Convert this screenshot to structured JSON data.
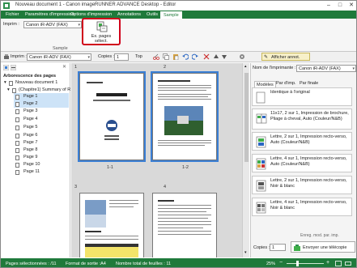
{
  "window": {
    "title": "Nouveau document 1 - Canon imageRUNNER ADVANCE Desktop - Editor",
    "minimize": "–",
    "maximize": "□",
    "close": "✕"
  },
  "ribbon": {
    "tabs": [
      "Fichier",
      "Paramètres d'impression",
      "Options d'impression",
      "Annotations",
      "Outils",
      "Sample"
    ],
    "active_tab_index": 5,
    "printer_label": "Imprim :",
    "printer_value": "Canon iR-ADV (FAX)",
    "sample_button_label_line1": "Ex. pages",
    "sample_button_label_line2": "sélect.",
    "group_label": "Sample"
  },
  "toolbar": {
    "printer_label": "Imprim :",
    "printer_value": "Canon iR-ADV (FAX)",
    "copies_label": "Copies :",
    "copies_value": "1",
    "top_label": "Top",
    "show_annotations_label": "Afficher annot."
  },
  "tree": {
    "header": "Arborescence des pages",
    "root_label": "Nouveau document 1",
    "chapter_label": "(Chapitre1) Summary of R",
    "pages": [
      "Page 1",
      "Page 2",
      "Page 3",
      "Page 4",
      "Page 5",
      "Page 6",
      "Page 7",
      "Page 8",
      "Page 9",
      "Page 10",
      "Page 11"
    ]
  },
  "center": {
    "page_numbers": [
      "1",
      "2",
      "3",
      "4"
    ],
    "captions": [
      "1-1",
      "1-2"
    ]
  },
  "right": {
    "printer_name_label": "Nom de l'imprimante :",
    "printer_name_value": "Canon iR-ADV (FAX)",
    "tabs": [
      "Modèles",
      "Par d'imp.",
      "Par finale"
    ],
    "favorites": [
      "Identique à l'original",
      "11x17, 2 sur 1, Impression de brochure, Pliage à cheval, Auto (Couleur/N&B)",
      "Lettre, 2 sur 1, Impression recto-verso, Auto (Couleur/N&B)",
      "Lettre, 4 sur 1, Impression recto-verso, Auto (Couleur/N&B)",
      "Lettre, 2 sur 1, Impression recto-verso, Noir & blanc",
      "Lettre, 4 sur 1, Impression recto-verso, Noir & blanc"
    ],
    "save_label": "Enreg. mod. par. imp.",
    "copies_label": "Copies :",
    "copies_value": "1",
    "send_label": "Envoyer une télécopie"
  },
  "status": {
    "selected_pages": "Pages sélectionnées : /11",
    "output_format": "Format de sortie :A4",
    "sheet_count": "Nombre total de feuilles : 11",
    "zoom": "25%"
  },
  "colors": {
    "ribbon_green": "#1f7a3b",
    "highlight_red": "#d0021b",
    "selection_blue": "#3a7fd5"
  }
}
